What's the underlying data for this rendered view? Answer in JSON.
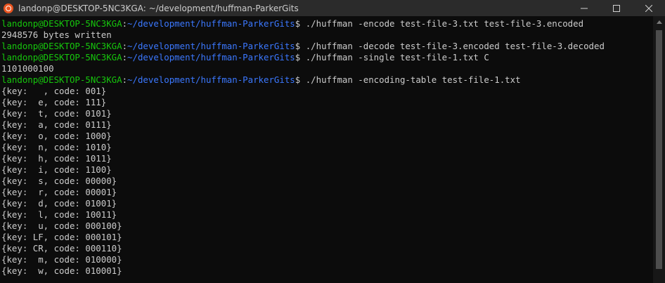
{
  "window": {
    "title": "landonp@DESKTOP-5NC3KGA: ~/development/huffman-ParkerGits"
  },
  "prompt": {
    "user": "landonp@DESKTOP-5NC3KGA",
    "sep": ":",
    "path": "~/development/huffman-ParkerGits",
    "symbol": "$"
  },
  "lines": [
    {
      "type": "cmd",
      "text": " ./huffman -encode test-file-3.txt test-file-3.encoded"
    },
    {
      "type": "out",
      "text": "2948576 bytes written"
    },
    {
      "type": "cmd",
      "text": " ./huffman -decode test-file-3.encoded test-file-3.decoded"
    },
    {
      "type": "cmd",
      "text": " ./huffman -single test-file-1.txt C"
    },
    {
      "type": "out",
      "text": "1101000100"
    },
    {
      "type": "cmd",
      "text": " ./huffman -encoding-table test-file-1.txt"
    },
    {
      "type": "out",
      "text": "{key:   , code: 001}"
    },
    {
      "type": "out",
      "text": "{key:  e, code: 111}"
    },
    {
      "type": "out",
      "text": "{key:  t, code: 0101}"
    },
    {
      "type": "out",
      "text": "{key:  a, code: 0111}"
    },
    {
      "type": "out",
      "text": "{key:  o, code: 1000}"
    },
    {
      "type": "out",
      "text": "{key:  n, code: 1010}"
    },
    {
      "type": "out",
      "text": "{key:  h, code: 1011}"
    },
    {
      "type": "out",
      "text": "{key:  i, code: 1100}"
    },
    {
      "type": "out",
      "text": "{key:  s, code: 00000}"
    },
    {
      "type": "out",
      "text": "{key:  r, code: 00001}"
    },
    {
      "type": "out",
      "text": "{key:  d, code: 01001}"
    },
    {
      "type": "out",
      "text": "{key:  l, code: 10011}"
    },
    {
      "type": "out",
      "text": "{key:  u, code: 000100}"
    },
    {
      "type": "out",
      "text": "{key: LF, code: 000101}"
    },
    {
      "type": "out",
      "text": "{key: CR, code: 000110}"
    },
    {
      "type": "out",
      "text": "{key:  m, code: 010000}"
    },
    {
      "type": "out",
      "text": "{key:  w, code: 010001}"
    }
  ],
  "icons": {
    "app": "ubuntu-icon",
    "minimize": "minimize-icon",
    "maximize": "maximize-icon",
    "close": "close-icon"
  },
  "colors": {
    "user": "#16c60c",
    "path": "#3b78ff",
    "text": "#cccccc",
    "background": "#0c0c0c",
    "titlebar": "#2b2b2b"
  }
}
